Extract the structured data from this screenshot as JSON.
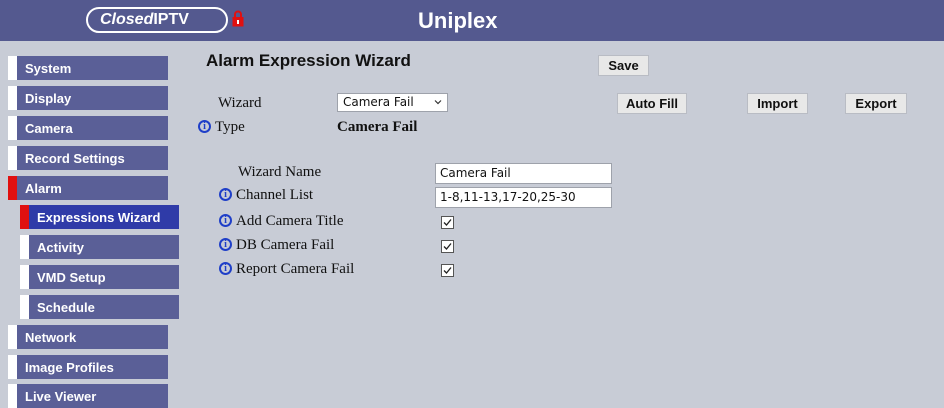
{
  "header": {
    "logo_part1": "Closed",
    "logo_part2": "IPTV",
    "brand": "Uniplex"
  },
  "sidebar": {
    "items": [
      {
        "label": "System"
      },
      {
        "label": "Display"
      },
      {
        "label": "Camera"
      },
      {
        "label": "Record Settings"
      },
      {
        "label": "Alarm"
      },
      {
        "label": "Expressions Wizard"
      },
      {
        "label": "Activity"
      },
      {
        "label": "VMD Setup"
      },
      {
        "label": "Schedule"
      },
      {
        "label": "Network"
      },
      {
        "label": "Image Profiles"
      },
      {
        "label": "Live Viewer"
      }
    ]
  },
  "main": {
    "title": "Alarm Expression Wizard",
    "save_label": "Save",
    "autofill_label": "Auto Fill",
    "import_label": "Import",
    "export_label": "Export",
    "wizard_label": "Wizard",
    "wizard_value": "Camera Fail",
    "type_label": "Type",
    "type_value": "Camera Fail",
    "wizard_name_label": "Wizard Name",
    "wizard_name_value": "Camera Fail",
    "channel_list_label": "Channel List",
    "channel_list_value": "1-8,11-13,17-20,25-30",
    "add_camera_title_label": "Add Camera Title",
    "add_camera_title_checked": true,
    "db_camera_fail_label": "DB Camera Fail",
    "db_camera_fail_checked": true,
    "report_camera_fail_label": "Report Camera Fail",
    "report_camera_fail_checked": true
  },
  "colors": {
    "header_bg": "#54598f",
    "nav_bg": "#5a5f97",
    "nav_active_bg": "#2f3ba8",
    "nav_marker": "#e01010",
    "info_icon": "#1f3fc8",
    "page_bg": "#c8ccd6"
  }
}
